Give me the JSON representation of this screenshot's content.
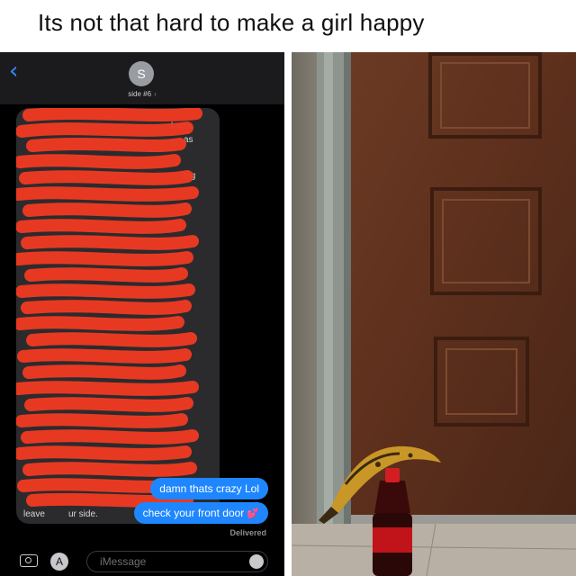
{
  "caption": {
    "text": "Its not that hard to make a girl happy"
  },
  "chat": {
    "back_icon": "chevron-left-icon",
    "avatar_initial": "S",
    "contact_name": "side #6",
    "received_fragments": [
      "know",
      "as",
      "ing",
      "leave",
      "ur side."
    ],
    "sent_messages": [
      "damn thats crazy Lol",
      "check your front door"
    ],
    "emoji": "💕",
    "status": "Delivered",
    "input_placeholder": "iMessage",
    "colors": {
      "sent_bubble": "#1e86ff",
      "scribble": "#ee3a22",
      "header": "#1b1b1d"
    }
  },
  "photo": {
    "subject": "wooden door with banana on soda bottle",
    "icons": [
      "door",
      "banana",
      "soda-bottle"
    ]
  }
}
